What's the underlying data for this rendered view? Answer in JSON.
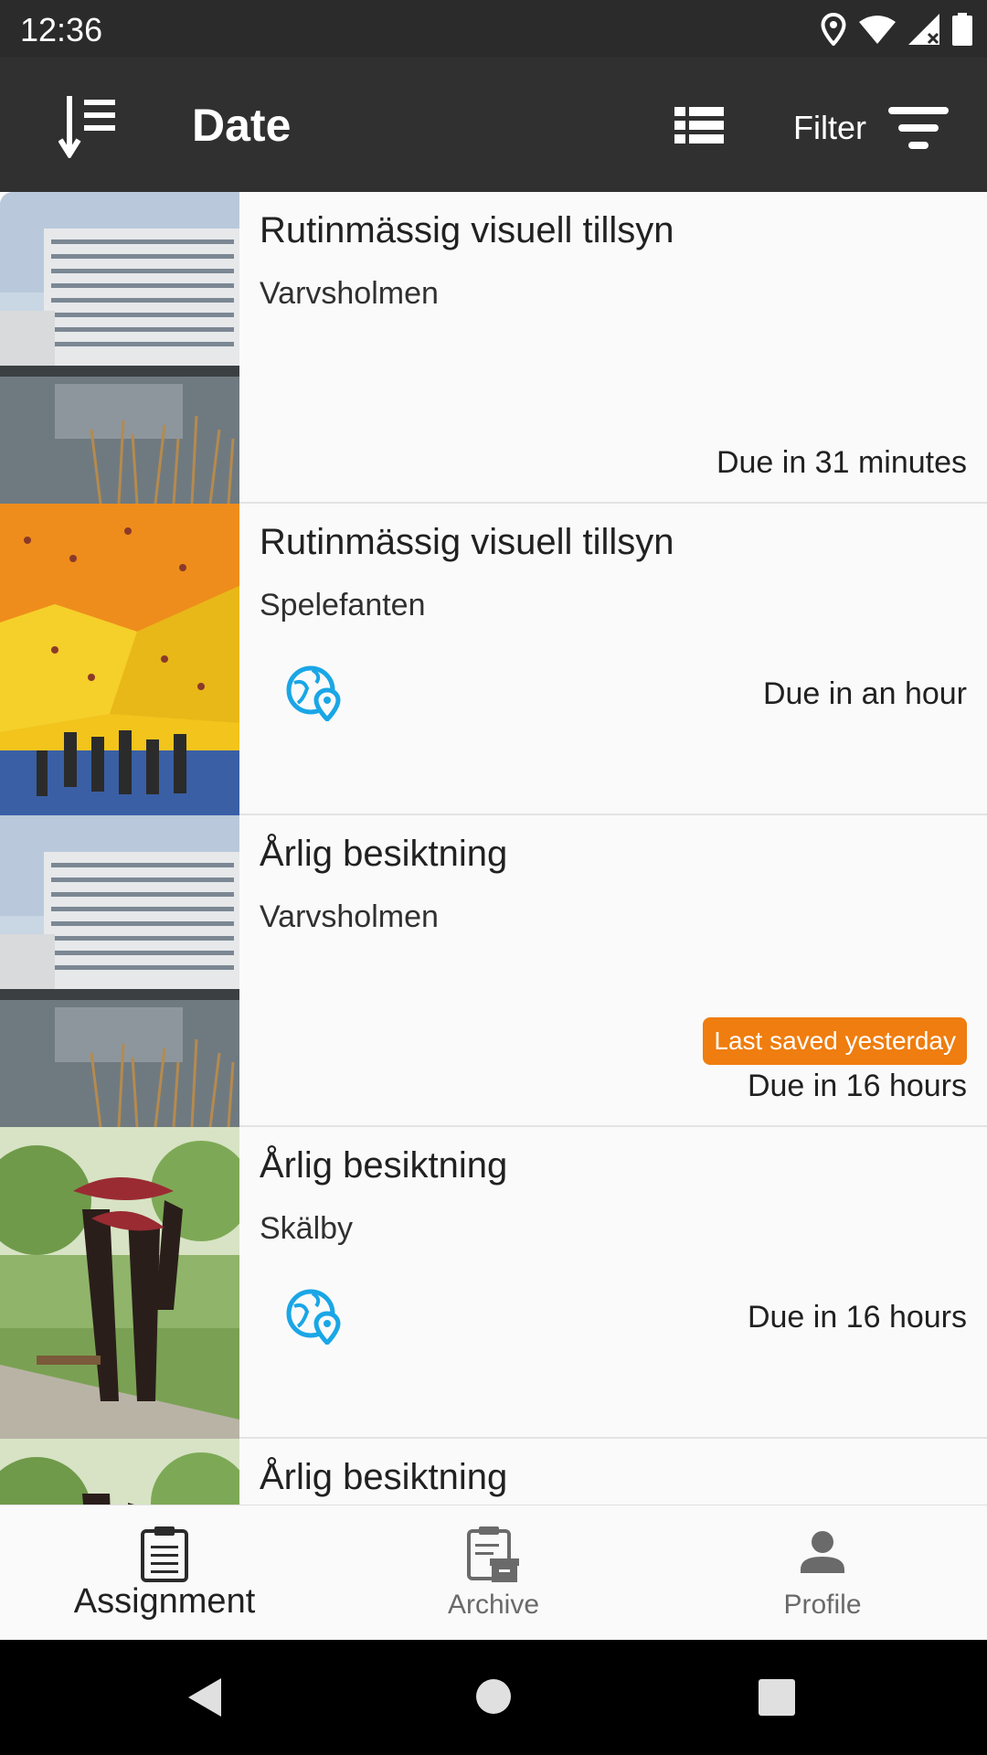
{
  "status_bar": {
    "time": "12:36"
  },
  "app_bar": {
    "sort_label": "Date",
    "filter_label": "Filter"
  },
  "assignments": [
    {
      "title": "Rutinmässig visuell tillsyn",
      "location": "Varvsholmen",
      "due": "Due in 31 minutes",
      "has_geo": false
    },
    {
      "title": "Rutinmässig visuell tillsyn",
      "location": "Spelefanten",
      "due": "Due in an hour",
      "has_geo": true
    },
    {
      "title": "Årlig besiktning",
      "location": "Varvsholmen",
      "due": "Due in 16 hours",
      "badge": "Last saved yesterday",
      "has_geo": false
    },
    {
      "title": "Årlig besiktning",
      "location": "Skälby",
      "due": "Due in 16 hours",
      "has_geo": true
    },
    {
      "title": "Årlig besiktning"
    }
  ],
  "bottom_nav": {
    "items": [
      {
        "label": "Assignment",
        "icon": "clipboard-icon",
        "active": true
      },
      {
        "label": "Archive",
        "icon": "archive-icon",
        "active": false
      },
      {
        "label": "Profile",
        "icon": "person-icon",
        "active": false
      }
    ]
  },
  "colors": {
    "accent": "#1aa6e6",
    "badge": "#ef7d0f",
    "app_bar": "#303030",
    "status_bar": "#2b2b2b"
  }
}
